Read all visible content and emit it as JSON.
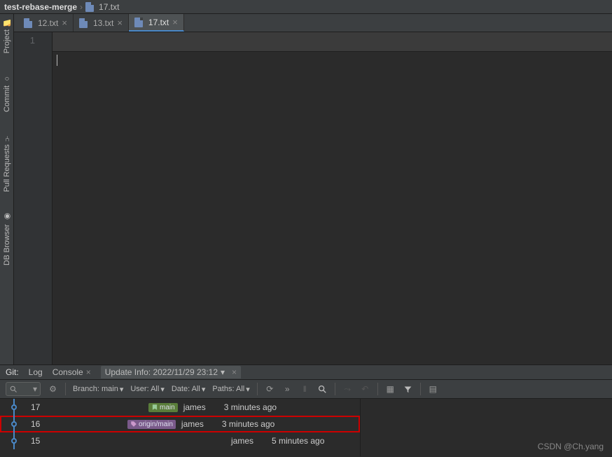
{
  "breadcrumb": {
    "project": "test-rebase-merge",
    "file": "17.txt"
  },
  "sidebar": {
    "items": [
      {
        "label": "Project"
      },
      {
        "label": "Commit"
      },
      {
        "label": "Pull Requests"
      },
      {
        "label": "DB Browser"
      }
    ]
  },
  "tabs": [
    {
      "label": "12.txt",
      "active": false
    },
    {
      "label": "13.txt",
      "active": false
    },
    {
      "label": "17.txt",
      "active": true
    }
  ],
  "editor": {
    "line_number": "1"
  },
  "bottom": {
    "title": "Git:",
    "sub_tabs": {
      "log": "Log",
      "console": "Console",
      "update_info": "Update Info: 2022/11/29 23:12"
    },
    "filters": {
      "branch": "Branch: main",
      "user": "User: All",
      "date": "Date: All",
      "paths": "Paths: All"
    }
  },
  "commits": [
    {
      "msg": "17",
      "tag": "main",
      "tag_class": "tag-main",
      "author": "james",
      "time": "3 minutes ago",
      "highlight": false
    },
    {
      "msg": "16",
      "tag": "origin/main",
      "tag_class": "tag-origin",
      "author": "james",
      "time": "3 minutes ago",
      "highlight": true
    },
    {
      "msg": "15",
      "tag": "",
      "tag_class": "",
      "author": "james",
      "time": "5 minutes ago",
      "highlight": false
    }
  ],
  "watermark": "CSDN @Ch.yang"
}
